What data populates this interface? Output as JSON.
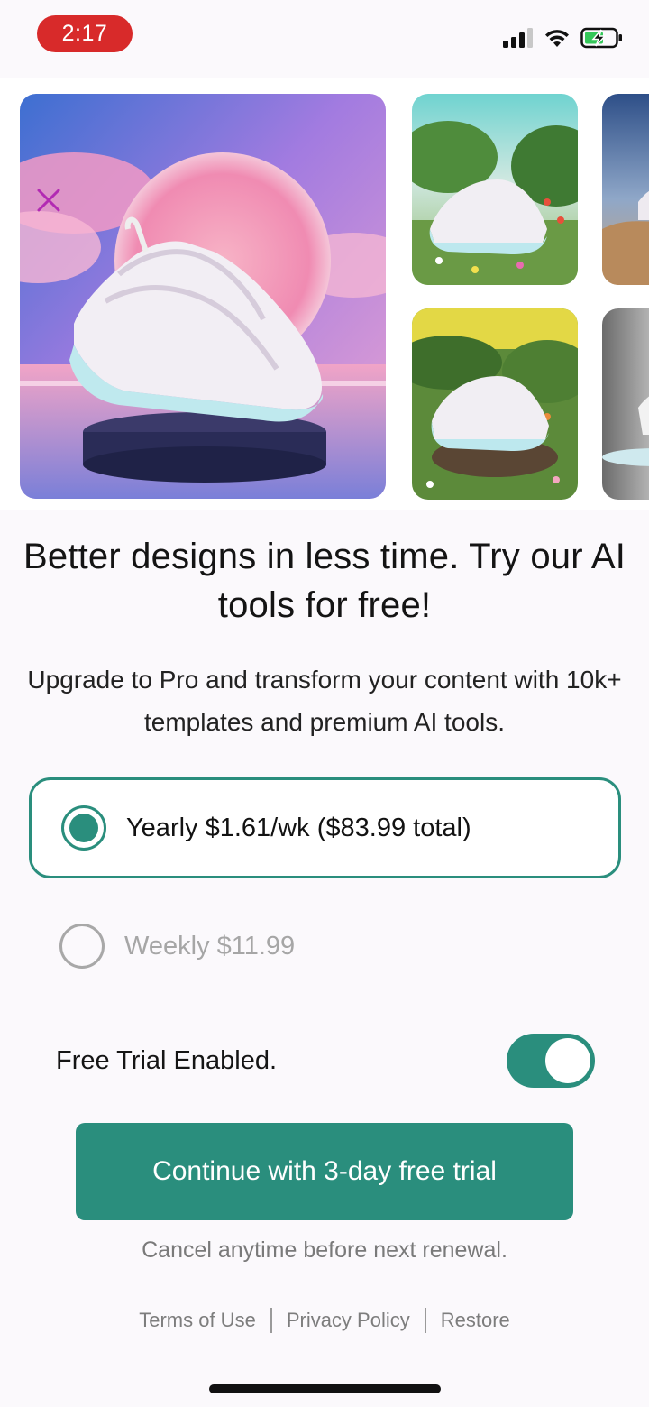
{
  "status_bar": {
    "time": "2:17",
    "icons": [
      "signal-icon",
      "wifi-icon",
      "battery-charging-icon"
    ],
    "time_pill_color": "#d82a2a"
  },
  "gallery": {
    "tiles": [
      "sneaker-sunset-platform",
      "sneaker-garden",
      "sneaker-desert",
      "sneaker-garden-rock",
      "sneaker-studio"
    ]
  },
  "header": {
    "headline": "Better designs in less time. Try our AI tools for free!",
    "subline": "Upgrade to Pro and transform your content with 10k+ templates and premium AI tools."
  },
  "plans": [
    {
      "label": "Yearly $1.61/wk ($83.99 total)",
      "selected": true
    },
    {
      "label": "Weekly $11.99",
      "selected": false
    }
  ],
  "trial": {
    "label": "Free Trial Enabled.",
    "enabled": true
  },
  "cta": {
    "label": "Continue with 3-day free trial"
  },
  "cancel_note": "Cancel anytime before next renewal.",
  "footer": {
    "links": [
      "Terms of Use",
      "Privacy Policy",
      "Restore"
    ]
  },
  "colors": {
    "accent": "#2a8e7d",
    "close_icon": "#b22ab3"
  }
}
